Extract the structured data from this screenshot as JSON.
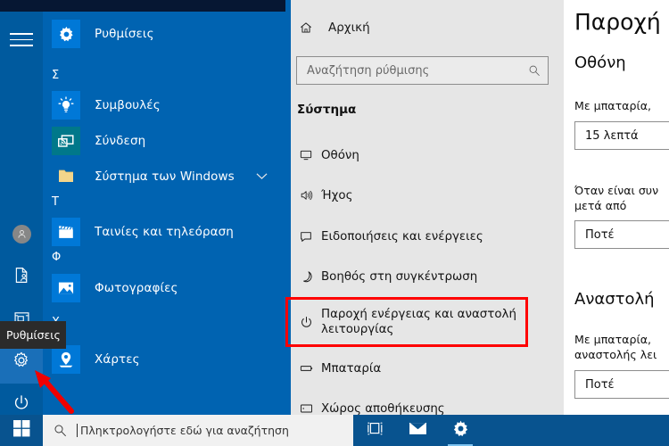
{
  "start_menu": {
    "hamburger_label": "hamburger-menu",
    "apps": [
      {
        "label": "Ρυθμίσεις",
        "icon": "gear-icon",
        "tile_color": "#0078d7",
        "group": null,
        "expandable": false
      },
      {
        "label": "Συμβουλές",
        "icon": "lightbulb-icon",
        "tile_color": "#0078d7",
        "group": "Σ",
        "expandable": false
      },
      {
        "label": "Σύνδεση",
        "icon": "cast-screen-icon",
        "tile_color": "#00788a",
        "group": null,
        "expandable": false
      },
      {
        "label": "Σύστημα των Windows",
        "icon": "folder-icon",
        "tile_color": "#0063b1",
        "group": null,
        "expandable": true
      },
      {
        "label": "Ταινίες και τηλεόραση",
        "icon": "clapperboard-icon",
        "tile_color": "#0078d7",
        "group": "Τ",
        "expandable": false
      },
      {
        "label": "Φωτογραφίες",
        "icon": "photo-icon",
        "tile_color": "#0078d7",
        "group": "Φ",
        "expandable": false
      },
      {
        "label": "Χάρτες",
        "icon": "map-pin-icon",
        "tile_color": "#0078d7",
        "group": "Χ",
        "expandable": false
      }
    ],
    "rail": [
      {
        "name": "user-account",
        "icon": "person-icon",
        "active": false
      },
      {
        "name": "documents",
        "icon": "document-icon",
        "active": false
      },
      {
        "name": "pictures",
        "icon": "picture-icon",
        "active": false
      },
      {
        "name": "settings",
        "icon": "gear-icon",
        "active": true
      },
      {
        "name": "power",
        "icon": "power-icon",
        "active": false
      }
    ],
    "tooltip": {
      "text": "Ρυθμίσεις"
    }
  },
  "settings": {
    "home": {
      "label": "Αρχική",
      "icon": "home-icon"
    },
    "search": {
      "value": "",
      "placeholder": "Αναζήτηση ρύθμισης",
      "icon": "search-icon"
    },
    "section_header": "Σύστημα",
    "nav_items": [
      {
        "label": "Οθόνη",
        "icon": "monitor-icon",
        "selected": false
      },
      {
        "label": "Ήχος",
        "icon": "speaker-icon",
        "selected": false
      },
      {
        "label": "Ειδοποιήσεις και ενέργειες",
        "icon": "notification-icon",
        "selected": false
      },
      {
        "label": "Βοηθός στη συγκέντρωση",
        "icon": "moon-icon",
        "selected": false
      },
      {
        "label": "Παροχή ενέργειας και αναστολή λειτουργίας",
        "icon": "power-icon",
        "selected": true
      },
      {
        "label": "Μπαταρία",
        "icon": "battery-icon",
        "selected": false
      },
      {
        "label": "Χώρος αποθήκευσης",
        "icon": "storage-icon",
        "selected": false
      }
    ],
    "highlight_color": "#ff0000",
    "accent_color": "#0063b1",
    "content": {
      "page_title": "Παροχή",
      "section_display_title": "Οθόνη",
      "field1_label": "Με μπαταρία,",
      "field1_value": "15 λεπτά",
      "field2_label_line1": "Όταν είναι συν",
      "field2_label_line2": "μετά από",
      "field2_value": "Ποτέ",
      "section_sleep_title": "Αναστολή",
      "field3_label_line1": "Με μπαταρία,",
      "field3_label_line2": "αναστολής λει",
      "field3_value": "Ποτέ"
    }
  },
  "taskbar": {
    "start_button": "windows-logo",
    "search": {
      "value": "",
      "placeholder": "Πληκτρολογήστε εδώ για αναζήτηση",
      "icon": "search-icon"
    },
    "items": [
      {
        "name": "task-view",
        "icon": "task-view-icon",
        "active": false
      },
      {
        "name": "mail",
        "icon": "mail-icon",
        "active": false
      },
      {
        "name": "settings-window",
        "icon": "gear-icon",
        "active": true
      }
    ]
  }
}
